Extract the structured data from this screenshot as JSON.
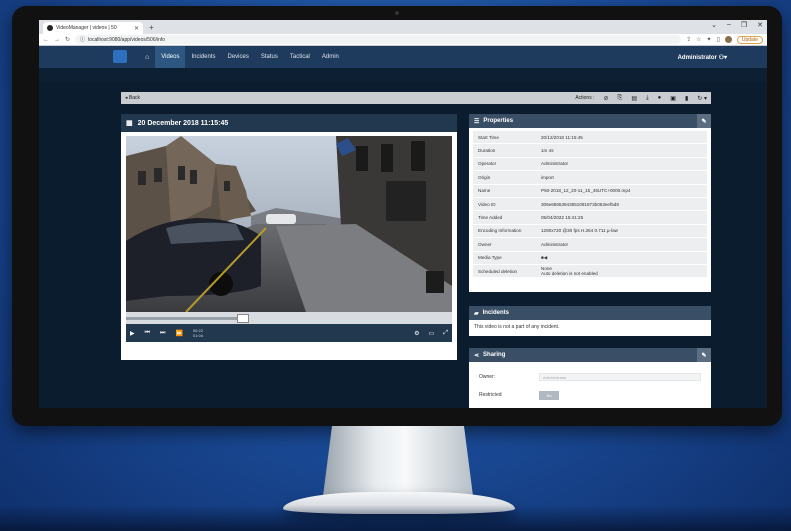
{
  "browser": {
    "tab_title": "VideoManager | videos | 50",
    "url": "localhost:9080/app/videos/506/info",
    "update_label": "Update"
  },
  "nav": {
    "items": [
      "Videos",
      "Incidents",
      "Devices",
      "Status",
      "Tactical",
      "Admin"
    ],
    "active": "Videos",
    "user": "Administrator"
  },
  "toolbar": {
    "back_label": "Back",
    "actions_label": "Actions :"
  },
  "video": {
    "title": "20 December 2018 11:15:45",
    "current_time": "00:22",
    "duration": "01:04",
    "progress": 0.36
  },
  "properties": {
    "title": "Properties",
    "rows": [
      {
        "key": "Start Time",
        "value": "20/12/2018 11:15:45"
      },
      {
        "key": "Duration",
        "value": "1m 4s"
      },
      {
        "key": "Operator",
        "value": "Administrator"
      },
      {
        "key": "Origin",
        "value": "import"
      },
      {
        "key": "Name",
        "value": "P50-2018_12_20-11_15_45UTC+0000.mp4"
      },
      {
        "key": "Video ID",
        "value": "306e68653943851081873b063eef5d8"
      },
      {
        "key": "Time Added",
        "value": "05/04/2022 15:41:25"
      },
      {
        "key": "Encoding Information",
        "value": "1280x720 @30 fps H.264 0.711 µ-law"
      },
      {
        "key": "Owner",
        "value": "Administrator"
      },
      {
        "key": "Media Type",
        "value": "■◀"
      },
      {
        "key": "Scheduled deletion",
        "value": "None",
        "value2": "Auto deletion is not enabled"
      }
    ]
  },
  "incidents": {
    "title": "Incidents",
    "message": "This video is not a part of any incident."
  },
  "sharing": {
    "title": "Sharing",
    "owner_label": "Owner:",
    "owner_placeholder": "Administrator",
    "restricted_label": "Restricted",
    "restricted_value": "No"
  }
}
